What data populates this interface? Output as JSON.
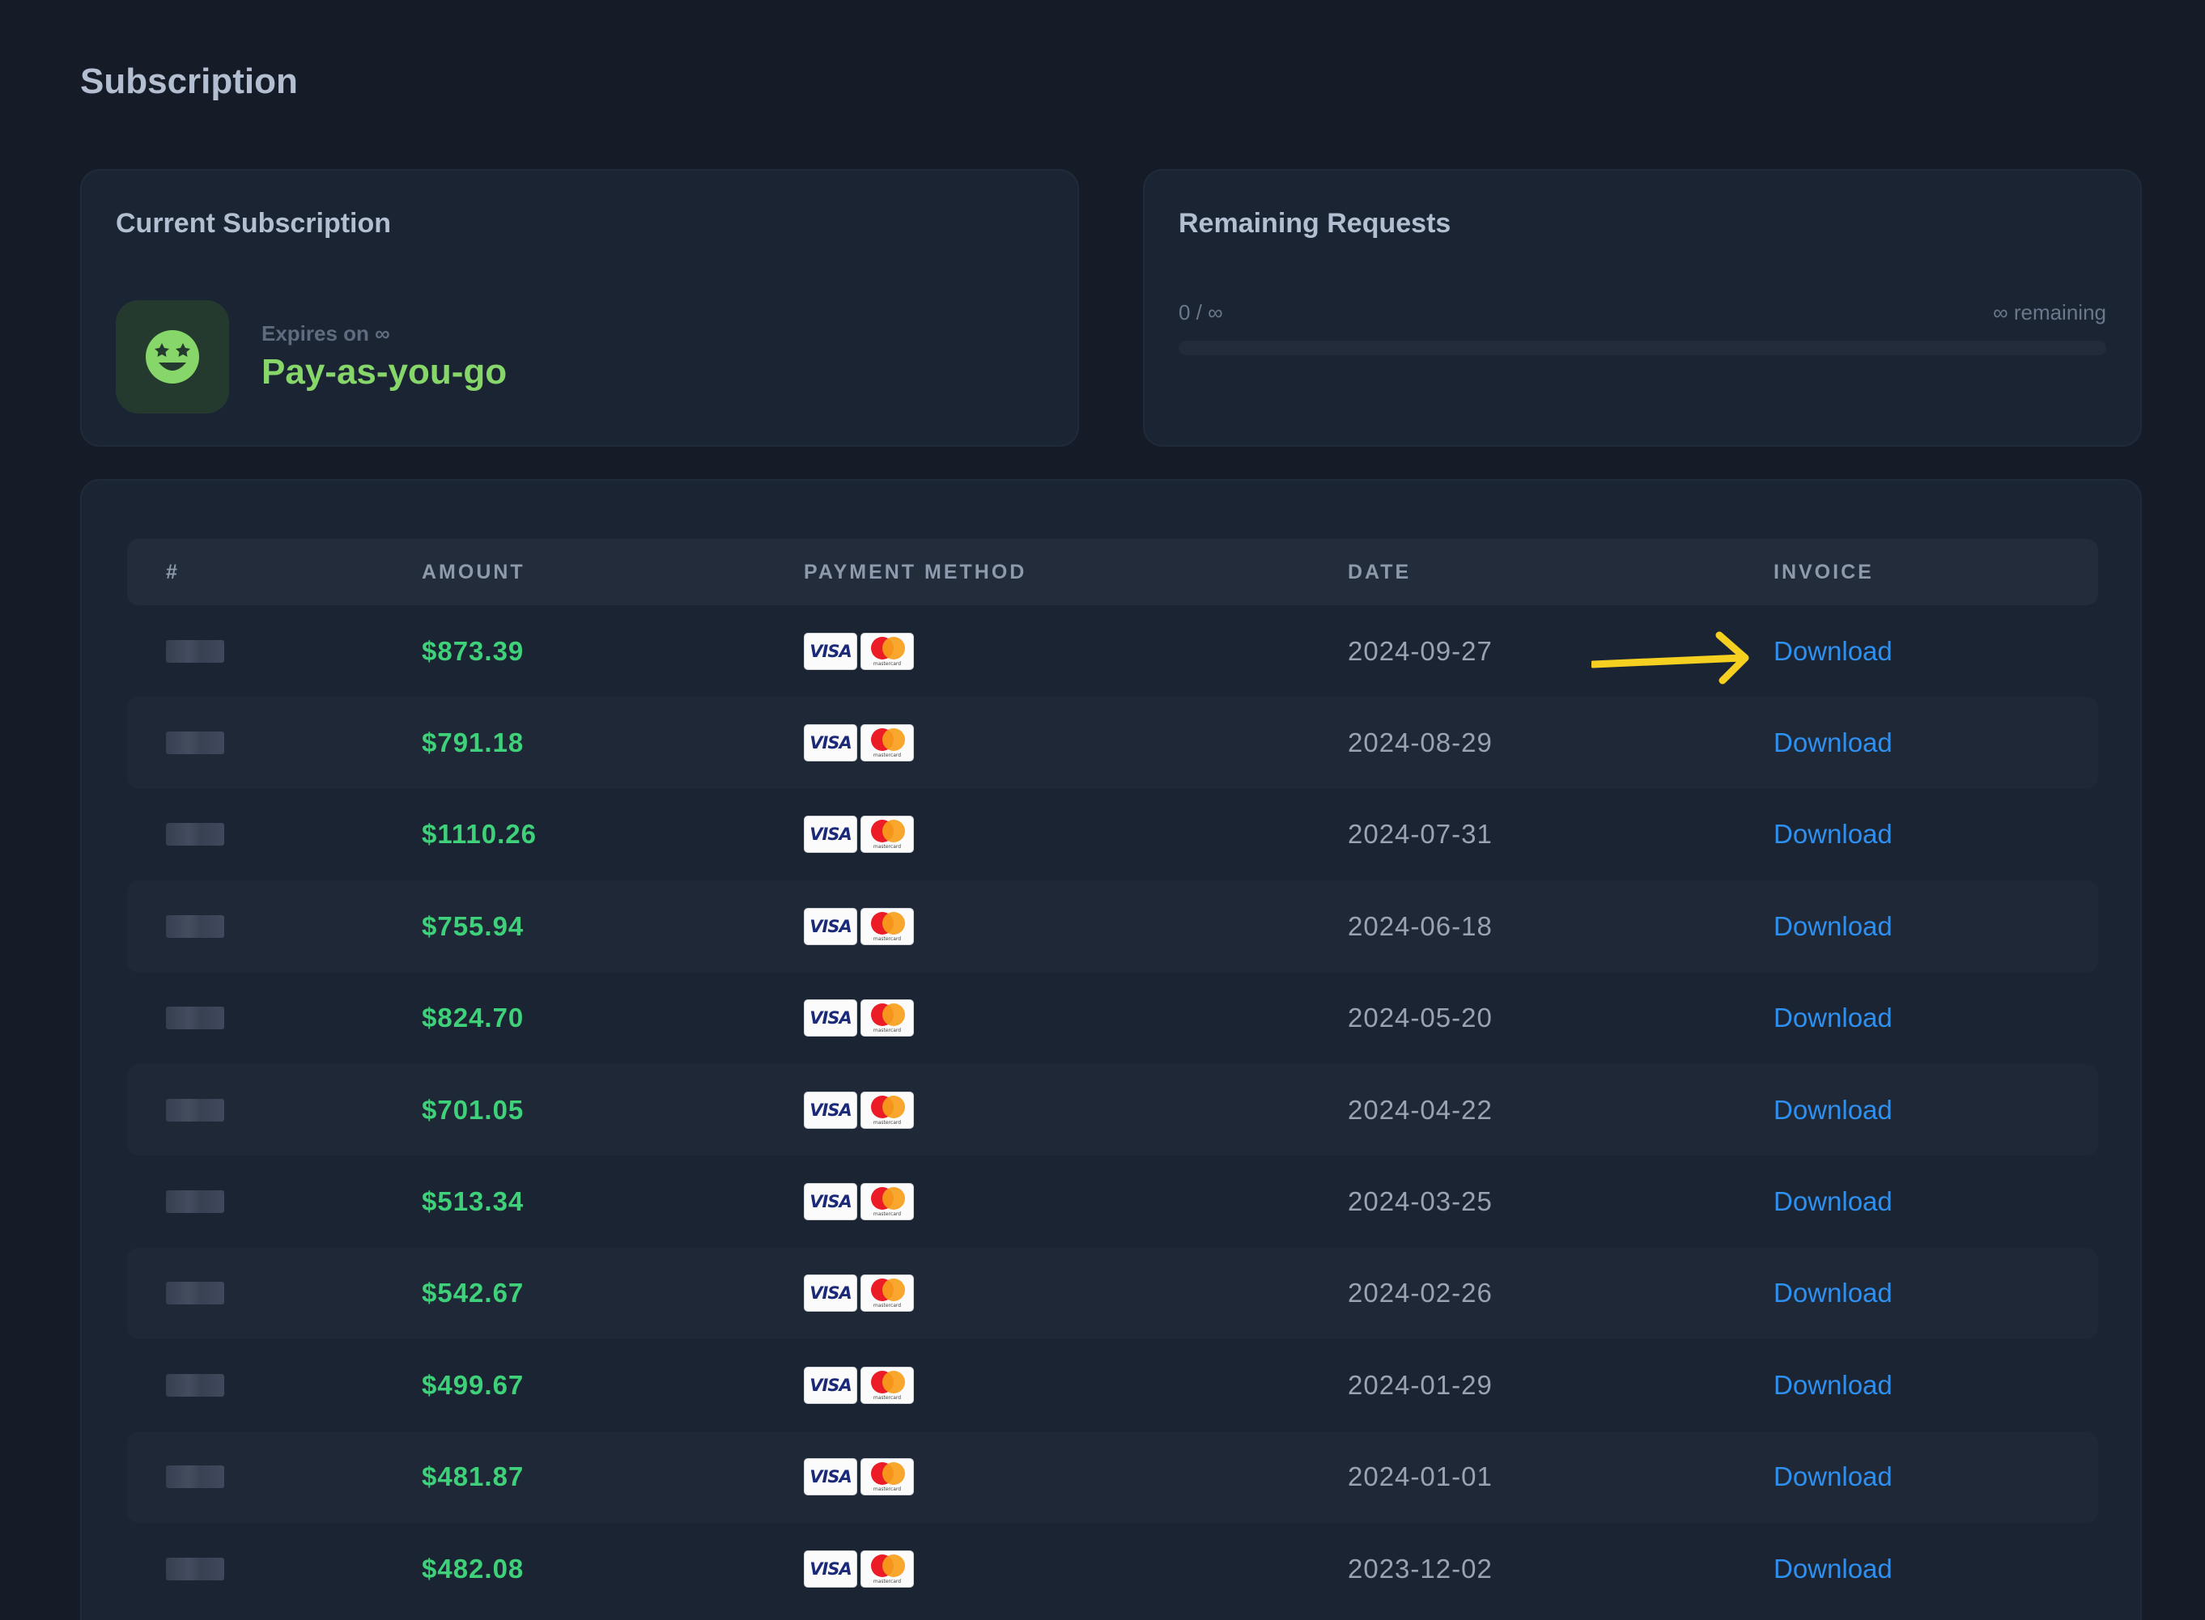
{
  "page": {
    "title": "Subscription"
  },
  "current_subscription": {
    "title": "Current Subscription",
    "icon": "star-eyes-smiley-icon",
    "expires_label": "Expires on ∞",
    "plan_name": "Pay-as-you-go",
    "accent_color": "#86d66a"
  },
  "remaining_requests": {
    "title": "Remaining Requests",
    "count_label": "0 / ∞",
    "remaining_label": "∞ remaining",
    "progress_fraction": 0
  },
  "table": {
    "headers": {
      "id": "#",
      "amount": "AMOUNT",
      "payment_method": "PAYMENT METHOD",
      "date": "DATE",
      "invoice": "INVOICE"
    },
    "rows": [
      {
        "amount": "$873.39",
        "date": "2024-09-27",
        "invoice": "Download"
      },
      {
        "amount": "$791.18",
        "date": "2024-08-29",
        "invoice": "Download"
      },
      {
        "amount": "$1110.26",
        "date": "2024-07-31",
        "invoice": "Download"
      },
      {
        "amount": "$755.94",
        "date": "2024-06-18",
        "invoice": "Download"
      },
      {
        "amount": "$824.70",
        "date": "2024-05-20",
        "invoice": "Download"
      },
      {
        "amount": "$701.05",
        "date": "2024-04-22",
        "invoice": "Download"
      },
      {
        "amount": "$513.34",
        "date": "2024-03-25",
        "invoice": "Download"
      },
      {
        "amount": "$542.67",
        "date": "2024-02-26",
        "invoice": "Download"
      },
      {
        "amount": "$499.67",
        "date": "2024-01-29",
        "invoice": "Download"
      },
      {
        "amount": "$481.87",
        "date": "2024-01-01",
        "invoice": "Download"
      },
      {
        "amount": "$482.08",
        "date": "2023-12-02",
        "invoice": "Download"
      }
    ],
    "payment_logos": {
      "visa": "VISA",
      "mastercard": "mastercard"
    },
    "amount_color": "#3fd07a",
    "link_color": "#2e90f0"
  },
  "annotation": {
    "arrow_color": "#f5d020"
  }
}
